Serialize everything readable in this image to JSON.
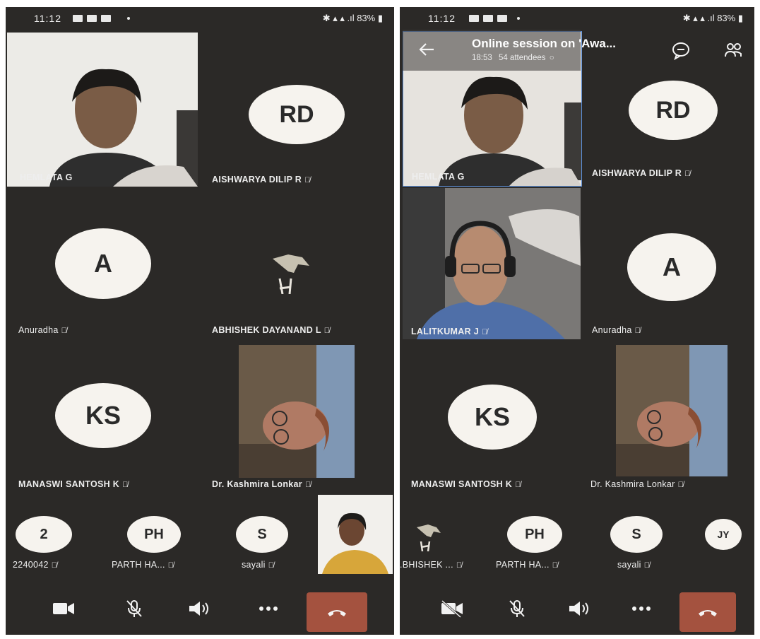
{
  "phone1": {
    "status": {
      "time": "11:12",
      "battery": "83%"
    },
    "tiles": [
      {
        "name": "HEMLATA G"
      },
      {
        "initials": "RD",
        "name": "AISHWARYA DILIP R"
      },
      {
        "initials": "A",
        "name": "Anuradha"
      },
      {
        "name": "ABHISHEK DAYANAND L"
      },
      {
        "initials": "KS",
        "name": "MANASWI SANTOSH K"
      },
      {
        "name": "Dr. Kashmira Lonkar"
      }
    ],
    "bottom_row": [
      {
        "initials": "2",
        "name": "2240042"
      },
      {
        "initials": "PH",
        "name": "PARTH HA..."
      },
      {
        "initials": "S",
        "name": "sayali"
      }
    ]
  },
  "phone2": {
    "status": {
      "time": "11:12",
      "battery": "83%"
    },
    "header": {
      "title": "Online session on 'Awa...",
      "duration": "18:53",
      "attendees": "54 attendees"
    },
    "tiles": [
      {
        "name": "HEMLATA G"
      },
      {
        "initials": "RD",
        "name": "AISHWARYA DILIP R"
      },
      {
        "name": "LALITKUMAR J"
      },
      {
        "initials": "A",
        "name": "Anuradha"
      },
      {
        "initials": "KS",
        "name": "MANASWI SANTOSH K"
      },
      {
        "name": "Dr. Kashmira Lonkar"
      }
    ],
    "bottom_row": [
      {
        "name": ".BHISHEK ..."
      },
      {
        "initials": "PH",
        "name": "PARTH HA..."
      },
      {
        "initials": "S",
        "name": "sayali"
      },
      {
        "initials": "JY"
      }
    ]
  },
  "icons": {
    "mic_off": "muted-mic-icon",
    "camera": "camera-icon",
    "speaker": "speaker-icon",
    "more": "more-icon",
    "end": "end-call-icon",
    "back": "back-arrow-icon",
    "chat": "chat-icon",
    "people": "participants-icon"
  },
  "colors": {
    "background": "#2b2927",
    "end_call": "#a4523f",
    "avatar": "#f6f3ee"
  }
}
